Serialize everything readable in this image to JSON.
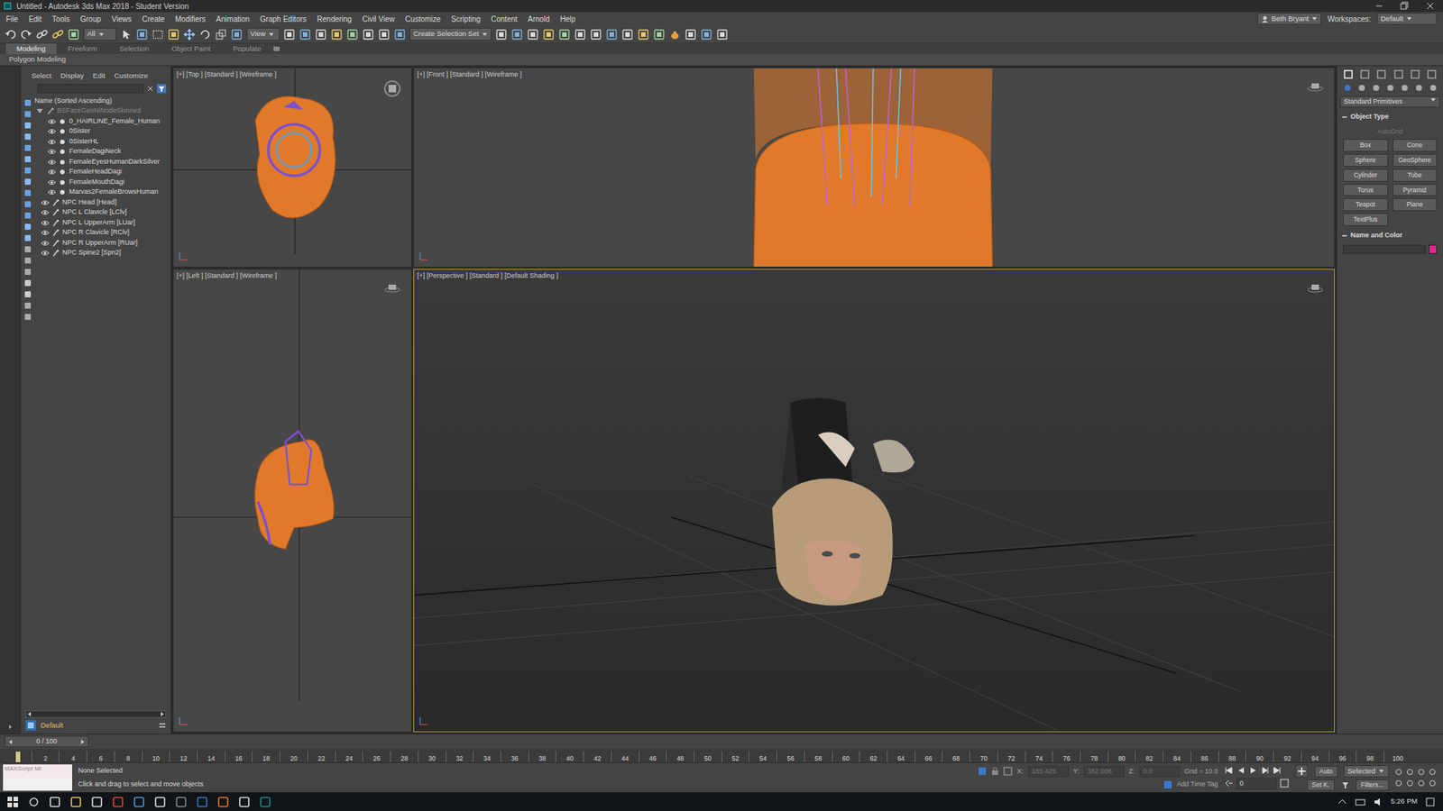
{
  "window": {
    "title": "Untitled - Autodesk 3ds Max 2018 - Student Version"
  },
  "menu": [
    "File",
    "Edit",
    "Tools",
    "Group",
    "Views",
    "Create",
    "Modifiers",
    "Animation",
    "Graph Editors",
    "Rendering",
    "Civil View",
    "Customize",
    "Scripting",
    "Content",
    "Arnold",
    "Help"
  ],
  "user": "Beth Bryant",
  "workspace": {
    "label": "Workspaces:",
    "value": "Default"
  },
  "toolbar": {
    "selection_filter": "All",
    "reference": "View",
    "selection_set": "Create Selection Set"
  },
  "ribbon_tabs": [
    {
      "label": "Modeling",
      "selected": true
    },
    {
      "label": "Freeform",
      "selected": false
    },
    {
      "label": "Selection",
      "selected": false
    },
    {
      "label": "Object Paint",
      "selected": false
    },
    {
      "label": "Populate",
      "selected": false
    }
  ],
  "ribbon_panel": "Polygon Modeling",
  "explorer": {
    "tabs": [
      "Select",
      "Display",
      "Edit",
      "Customize"
    ],
    "header": "Name (Sorted Ascending)",
    "items": [
      {
        "name": "BSFaceGenNiNodeSkinned",
        "kind": "root",
        "dimmed": true
      },
      {
        "name": "0_HAIRLINE_Female_Human",
        "kind": "mesh",
        "dimmed": false
      },
      {
        "name": "0Sister",
        "kind": "mesh",
        "dimmed": false
      },
      {
        "name": "0SisterHL",
        "kind": "mesh",
        "dimmed": false
      },
      {
        "name": "FemaleDagiNeck",
        "kind": "mesh",
        "dimmed": false
      },
      {
        "name": "FemaleEyesHumanDarkSilver",
        "kind": "mesh",
        "dimmed": false
      },
      {
        "name": "FemaleHeadDagi",
        "kind": "mesh",
        "dimmed": false
      },
      {
        "name": "FemaleMouthDagi",
        "kind": "mesh",
        "dimmed": false
      },
      {
        "name": "Marvas2FemaleBrowsHuman",
        "kind": "mesh",
        "dimmed": false
      },
      {
        "name": "NPC Head [Head]",
        "kind": "bone",
        "dimmed": false
      },
      {
        "name": "NPC L Clavicle [LClv]",
        "kind": "bone",
        "dimmed": false
      },
      {
        "name": "NPC L UpperArm [LUar]",
        "kind": "bone",
        "dimmed": false
      },
      {
        "name": "NPC R Clavicle [RClv]",
        "kind": "bone",
        "dimmed": false
      },
      {
        "name": "NPC R UpperArm [RUar]",
        "kind": "bone",
        "dimmed": false
      },
      {
        "name": "NPC Spine2 [Spn2]",
        "kind": "bone",
        "dimmed": false
      }
    ],
    "layer": "Default"
  },
  "viewports": [
    {
      "label": "[+] [Top ] [Standard ] [Wireframe ]",
      "kind": "top",
      "active": false
    },
    {
      "label": "[+] [Front ] [Standard ] [Wireframe ]",
      "kind": "front",
      "active": false
    },
    {
      "label": "[+] [Left ] [Standard ] [Wireframe ]",
      "kind": "left",
      "active": false
    },
    {
      "label": "[+] [Perspective ] [Standard ] [Default Shading ]",
      "kind": "perspective",
      "active": true
    }
  ],
  "command_panel": {
    "category": "Standard Primitives",
    "object_type": "Object Type",
    "autogrid": {
      "label": "AutoGrid",
      "disabled": true
    },
    "buttons": [
      "Box",
      "Cone",
      "Sphere",
      "GeoSphere",
      "Cylinder",
      "Tube",
      "Torus",
      "Pyramid",
      "Teapot",
      "Plane",
      "TextPlus"
    ],
    "name_and_color": "Name and Color",
    "color": "#e0288a"
  },
  "timeline": {
    "frame": "0 / 100",
    "ticks": [
      "2",
      "4",
      "6",
      "8",
      "10",
      "12",
      "14",
      "16",
      "18",
      "20",
      "22",
      "24",
      "26",
      "28",
      "30",
      "32",
      "34",
      "36",
      "38",
      "40",
      "42",
      "44",
      "46",
      "48",
      "50",
      "52",
      "54",
      "56",
      "58",
      "60",
      "62",
      "64",
      "66",
      "68",
      "70",
      "72",
      "74",
      "76",
      "78",
      "80",
      "82",
      "84",
      "86",
      "88",
      "90",
      "92",
      "94",
      "96",
      "98",
      "100"
    ]
  },
  "status": {
    "maxscript": "MAXScript Mi:",
    "selection": "None Selected",
    "prompt": "Click and drag to select and move objects",
    "x_label": "X:",
    "x": "185.425",
    "y_label": "Y:",
    "y": "382.008",
    "z_label": "Z:",
    "z": "0.0",
    "grid": "Grid = 10.0",
    "time_tag": "Add Time Tag",
    "auto": "Auto",
    "key_filter": "Selected",
    "set_key": "Set K.",
    "filters": "Filters...",
    "frame": "0"
  },
  "taskbar": {
    "time": "5:26 PM"
  }
}
